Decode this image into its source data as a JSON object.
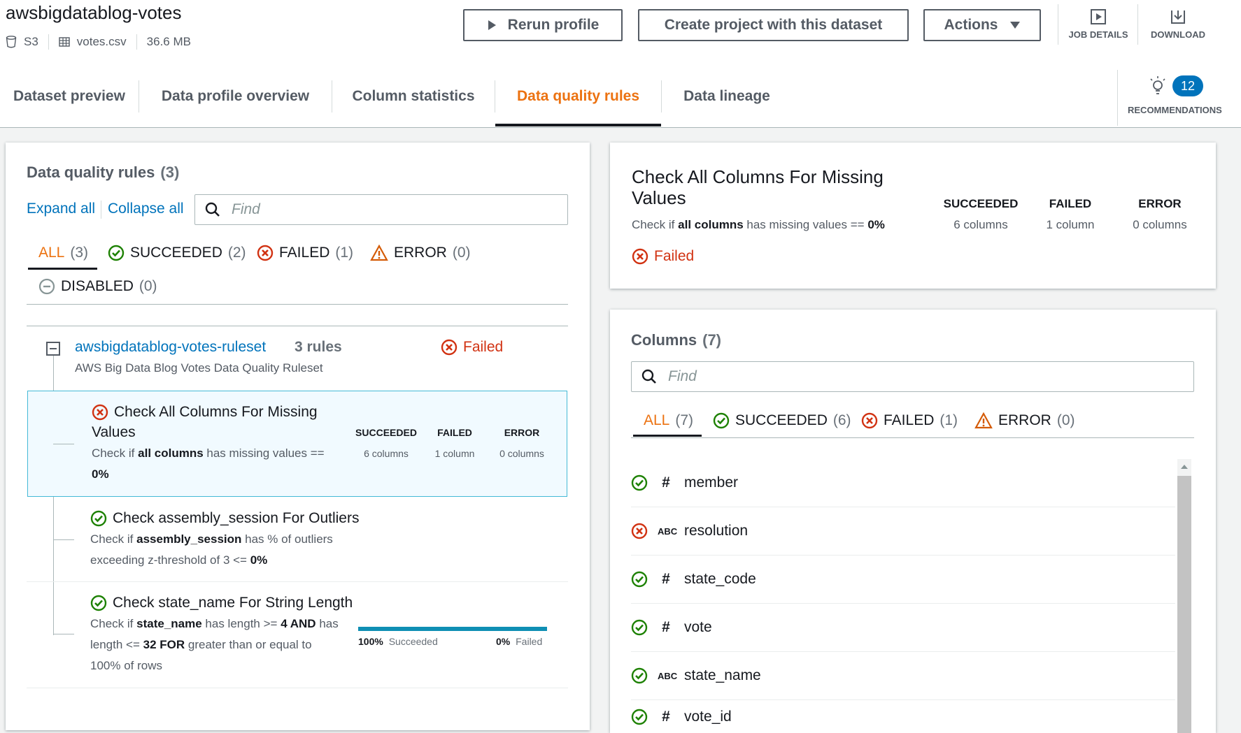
{
  "dataset": {
    "title": "awsbigdatablog-votes",
    "source": "S3",
    "file": "votes.csv",
    "size": "36.6 MB"
  },
  "toolbar": {
    "rerun_label": "Rerun profile",
    "create_project_label": "Create project with this dataset",
    "actions_label": "Actions",
    "job_details_label": "JOB DETAILS",
    "download_label": "DOWNLOAD"
  },
  "tabs": [
    {
      "label": "Dataset preview"
    },
    {
      "label": "Data profile overview"
    },
    {
      "label": "Column statistics"
    },
    {
      "label": "Data quality rules",
      "active": true
    },
    {
      "label": "Data lineage"
    }
  ],
  "recommendations": {
    "count": "12",
    "label": "RECOMMENDATIONS"
  },
  "rules_panel": {
    "title": "Data quality rules",
    "count": "(3)",
    "expand_all": "Expand all",
    "collapse_all": "Collapse all",
    "search_placeholder": "Find",
    "filters": {
      "all": {
        "label": "ALL",
        "count": "(3)"
      },
      "succeeded": {
        "label": "SUCCEEDED",
        "count": "(2)"
      },
      "failed": {
        "label": "FAILED",
        "count": "(1)"
      },
      "error": {
        "label": "ERROR",
        "count": "(0)"
      },
      "disabled": {
        "label": "DISABLED",
        "count": "(0)"
      }
    },
    "ruleset": {
      "name": "awsbigdatablog-votes-ruleset",
      "rule_count": "3 rules",
      "status": "Failed",
      "description": "AWS Big Data Blog Votes Data Quality Ruleset"
    },
    "rules": [
      {
        "name_line1": "Check All Columns For Missing",
        "name_line2": "Values",
        "desc": {
          "a": "Check if ",
          "b": "all columns",
          "c": " has missing values ==",
          "d": "0%"
        },
        "stats": {
          "succeeded_label": "SUCCEEDED",
          "failed_label": "FAILED",
          "error_label": "ERROR",
          "succeeded": "6 columns",
          "failed": "1 column",
          "error": "0 columns"
        },
        "status": "failed"
      },
      {
        "name": "Check assembly_session For Outliers",
        "desc": {
          "a": "Check if ",
          "b": "assembly_session",
          "c": " has % of outliers",
          "d": "exceeding z-threshold of 3 <= ",
          "e": "0%"
        },
        "status": "succeeded"
      },
      {
        "name": "Check state_name For String Length",
        "desc": {
          "a": "Check if ",
          "b": "state_name",
          "c": " has length >= ",
          "d": "4",
          "e": " AND",
          "f": " has",
          "g": "length <= ",
          "h": "32",
          "i": " FOR",
          "j": " greater than or equal to",
          "k": "100% of rows"
        },
        "progress": {
          "succeeded_pct": "100%",
          "succeeded_label": "Succeeded",
          "failed_pct": "0%",
          "failed_label": "Failed",
          "fraction_succeeded": 1.0
        },
        "status": "succeeded"
      }
    ]
  },
  "detail_panel": {
    "title_line1": "Check All Columns For Missing",
    "title_line2": "Values",
    "desc": {
      "a": "Check if ",
      "b": "all columns",
      "c": " has missing values == ",
      "d": "0%"
    },
    "status": "Failed",
    "stats": {
      "succeeded_label": "SUCCEEDED",
      "failed_label": "FAILED",
      "error_label": "ERROR",
      "succeeded": "6 columns",
      "failed": "1 column",
      "error": "0 columns"
    }
  },
  "columns_panel": {
    "title": "Columns",
    "count": "(7)",
    "search_placeholder": "Find",
    "filters": {
      "all": {
        "label": "ALL",
        "count": "(7)"
      },
      "succeeded": {
        "label": "SUCCEEDED",
        "count": "(6)"
      },
      "failed": {
        "label": "FAILED",
        "count": "(1)"
      },
      "error": {
        "label": "ERROR",
        "count": "(0)"
      }
    },
    "columns": [
      {
        "name": "member",
        "type": "#",
        "status": "succeeded"
      },
      {
        "name": "resolution",
        "type": "ABC",
        "status": "failed"
      },
      {
        "name": "state_code",
        "type": "#",
        "status": "succeeded"
      },
      {
        "name": "vote",
        "type": "#",
        "status": "succeeded"
      },
      {
        "name": "state_name",
        "type": "ABC",
        "status": "succeeded"
      },
      {
        "name": "vote_id",
        "type": "#",
        "status": "succeeded"
      }
    ]
  },
  "colors": {
    "accent": "#ec7211",
    "success": "#1d8102",
    "error": "#d13212",
    "warning": "#ff9900",
    "link": "#0073bb",
    "badge": "#0073bb"
  }
}
